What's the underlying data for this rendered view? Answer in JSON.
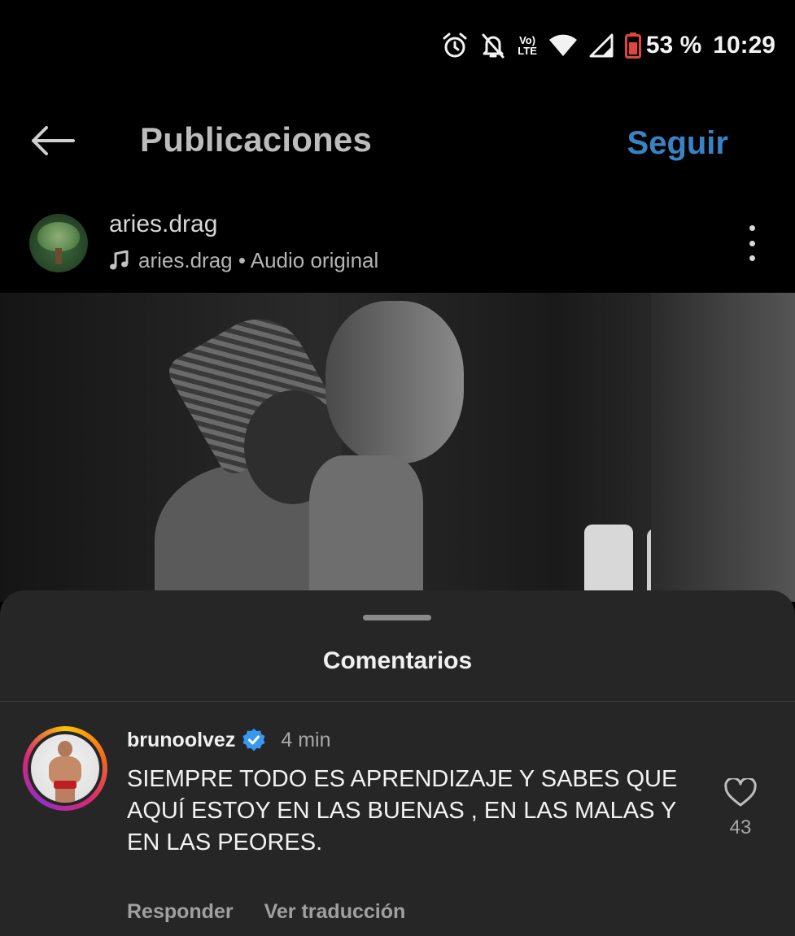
{
  "status_bar": {
    "battery": "53 %",
    "time": "10:29",
    "network_label_top": "Vo)",
    "network_label_bottom": "LTE",
    "icons": [
      "alarm-icon",
      "bell-off-icon",
      "volte-icon",
      "wifi-icon",
      "signal-icon",
      "battery-icon"
    ]
  },
  "header": {
    "title": "Publicaciones",
    "follow_label": "Seguir",
    "back_icon": "arrow-left-icon"
  },
  "post": {
    "username": "aries.drag",
    "audio": "aries.drag • Audio original",
    "audio_icon": "music-note-icon",
    "more_icon": "more-vertical-icon"
  },
  "comments_sheet": {
    "title": "Comentarios",
    "comments": [
      {
        "username": "brunoolvez",
        "verified": true,
        "time": "4 min",
        "text": "SIEMPRE TODO ES APRENDIZAJE Y SABES QUE AQUÍ ESTOY EN LAS BUENAS , EN LAS MALAS Y EN LAS PEORES.",
        "likes": "43",
        "reply_label": "Responder",
        "translate_label": "Ver traducción"
      }
    ]
  },
  "colors": {
    "background": "#000000",
    "sheet": "#262626",
    "follow": "#3b82c4",
    "verified": "#3897f0"
  }
}
